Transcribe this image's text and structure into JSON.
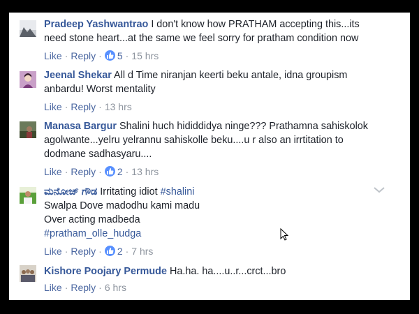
{
  "actions": {
    "like": "Like",
    "reply": "Reply"
  },
  "colors": {
    "link": "#365899",
    "action": "#4b67a1",
    "meta": "#8d949e",
    "like_badge": "#5890ff"
  },
  "comments": [
    {
      "author": "Pradeep Yashwantrao",
      "text_line1": "I don't know how PRATHAM accepting this...its",
      "text_line2": "need stone heart...at the same we feel sorry for pratham condition now",
      "likes": "5",
      "time": "15 hrs",
      "avatar": "mountain-landscape-avatar"
    },
    {
      "author": "Jeenal Shekar",
      "text_line1": "All d Time niranjan keerti beku antale, idna groupism",
      "text_line2": "anbardu! Worst mentality",
      "time": "13 hrs",
      "avatar": "illustrated-woman-avatar"
    },
    {
      "author": "Manasa Bargur",
      "text_line1": "Shalini huch hididdidya ninge??? Prathamna sahiskolok",
      "text_line2": "agolwante...yelru yelrannu sahiskolle beku....u r also an irrtitation to",
      "text_line3": "dodmane sadhasyaru....",
      "likes": "2",
      "time": "13 hrs",
      "avatar": "outdoor-photo-avatar"
    },
    {
      "author": "ಮನೋಜ್ ಗೌಡ",
      "text_line1": "Irritating idiot",
      "hashtag1": "#shalini",
      "text_line2": "Swalpa Dove madodhu kami madu",
      "text_line3": "Over acting madbeda",
      "hashtag2": "#pratham_olle_hudga",
      "likes": "2",
      "time": "7 hrs",
      "avatar": "person-photo-avatar"
    },
    {
      "author": "Kishore Poojary Permude",
      "text_line1": "Ha.ha. ha....u..r...crct...bro",
      "time": "6 hrs",
      "avatar": "group-photo-avatar"
    }
  ]
}
